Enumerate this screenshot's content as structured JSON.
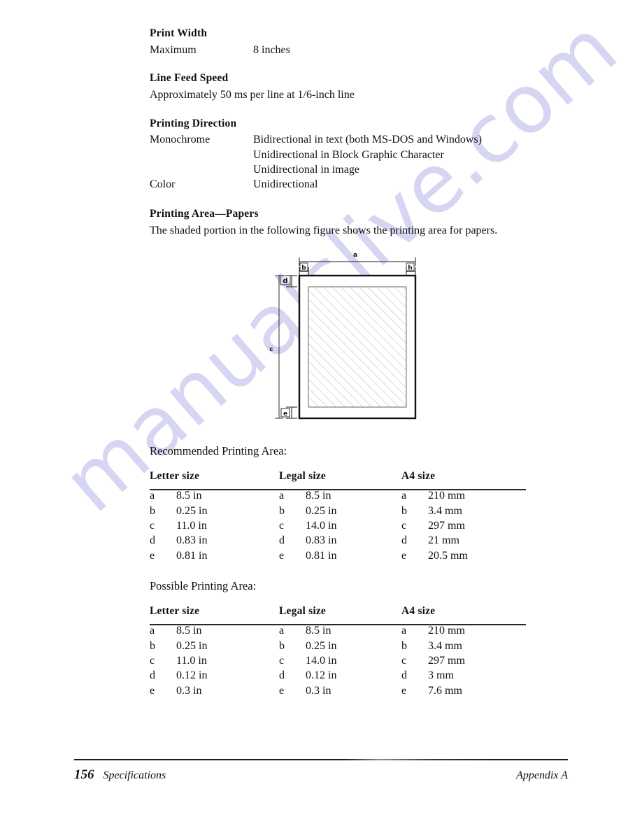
{
  "document": {
    "watermark": "manualslive.com"
  },
  "sections": {
    "print_width": {
      "heading": "Print Width",
      "label": "Maximum",
      "value": "8 inches"
    },
    "line_feed_speed": {
      "heading": "Line Feed Speed",
      "text": "Approximately 50 ms per line at 1/6-inch line"
    },
    "printing_direction": {
      "heading": "Printing Direction",
      "rows": [
        {
          "label": "Monochrome",
          "values": [
            "Bidirectional in text (both MS-DOS and Windows)",
            "Unidirectional in Block Graphic Character",
            "Unidirectional in image"
          ]
        },
        {
          "label": "Color",
          "values": [
            "Unidirectional"
          ]
        }
      ]
    },
    "printing_area": {
      "heading": "Printing Area—Papers",
      "text": "The shaded portion in the following figure shows the printing area for papers."
    }
  },
  "figure": {
    "labels": {
      "a": "a",
      "b_left": "b",
      "b_right": "h",
      "c": "c",
      "d": "d",
      "e": "e"
    }
  },
  "tables": [
    {
      "id": "recommended",
      "caption": "Recommended Printing Area:",
      "columns": [
        {
          "header": "Letter size",
          "rows": [
            {
              "key": "a",
              "value": "8.5 in"
            },
            {
              "key": "b",
              "value": "0.25 in"
            },
            {
              "key": "c",
              "value": "11.0 in"
            },
            {
              "key": "d",
              "value": "0.83 in"
            },
            {
              "key": "e",
              "value": "0.81 in"
            }
          ]
        },
        {
          "header": "Legal size",
          "rows": [
            {
              "key": "a",
              "value": "8.5 in"
            },
            {
              "key": "b",
              "value": "0.25 in"
            },
            {
              "key": "c",
              "value": "14.0 in"
            },
            {
              "key": "d",
              "value": "0.83 in"
            },
            {
              "key": "e",
              "value": "0.81 in"
            }
          ]
        },
        {
          "header": "A4 size",
          "rows": [
            {
              "key": "a",
              "value": "210 mm"
            },
            {
              "key": "b",
              "value": "3.4 mm"
            },
            {
              "key": "c",
              "value": "297 mm"
            },
            {
              "key": "d",
              "value": "21 mm"
            },
            {
              "key": "e",
              "value": "20.5 mm"
            }
          ]
        }
      ]
    },
    {
      "id": "possible",
      "caption": "Possible Printing Area:",
      "columns": [
        {
          "header": "Letter size",
          "rows": [
            {
              "key": "a",
              "value": "8.5 in"
            },
            {
              "key": "b",
              "value": "0.25 in"
            },
            {
              "key": "c",
              "value": "11.0 in"
            },
            {
              "key": "d",
              "value": "0.12 in"
            },
            {
              "key": "e",
              "value": "0.3 in"
            }
          ]
        },
        {
          "header": "Legal size",
          "rows": [
            {
              "key": "a",
              "value": "8.5 in"
            },
            {
              "key": "b",
              "value": "0.25 in"
            },
            {
              "key": "c",
              "value": "14.0 in"
            },
            {
              "key": "d",
              "value": "0.12 in"
            },
            {
              "key": "e",
              "value": "0.3 in"
            }
          ]
        },
        {
          "header": "A4 size",
          "rows": [
            {
              "key": "a",
              "value": "210 mm"
            },
            {
              "key": "b",
              "value": "3.4 mm"
            },
            {
              "key": "c",
              "value": "297 mm"
            },
            {
              "key": "d",
              "value": "3 mm"
            },
            {
              "key": "e",
              "value": "7.6 mm"
            }
          ]
        }
      ]
    }
  ],
  "footer": {
    "page_number": "156",
    "chapter_title": "Specifications",
    "appendix": "Appendix A"
  }
}
